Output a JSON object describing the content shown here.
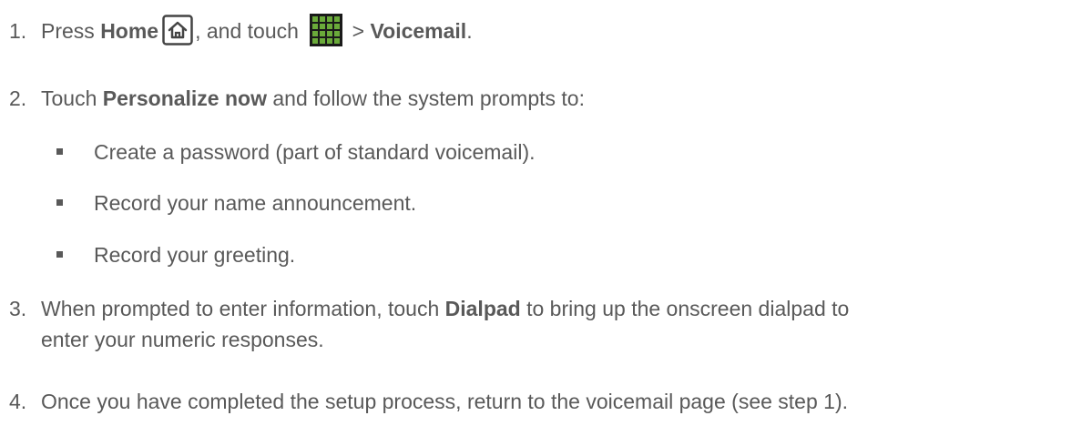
{
  "steps": [
    {
      "num": "1.",
      "t1": "Press ",
      "b1": "Home",
      "icon1": "home-key-icon",
      "t2": ", and touch ",
      "icon2": "apps-grid-icon",
      "t3": " > ",
      "b2": "Voicemail",
      "t4": "."
    },
    {
      "num": "2.",
      "t1": "Touch ",
      "b1": "Personalize now",
      "t2": " and follow the system prompts to:"
    },
    {
      "num": "3.",
      "t1": "When prompted to enter information, touch ",
      "b1": "Dialpad",
      "t2": " to bring up the onscreen dialpad to",
      "cont": "enter your numeric responses."
    },
    {
      "num": "4.",
      "t1": "Once you have completed the setup process, return to the voicemail page (see step 1)."
    }
  ],
  "bullets": [
    "Create a password (part of standard voicemail).",
    "Record your name announcement.",
    "Record your greeting."
  ]
}
